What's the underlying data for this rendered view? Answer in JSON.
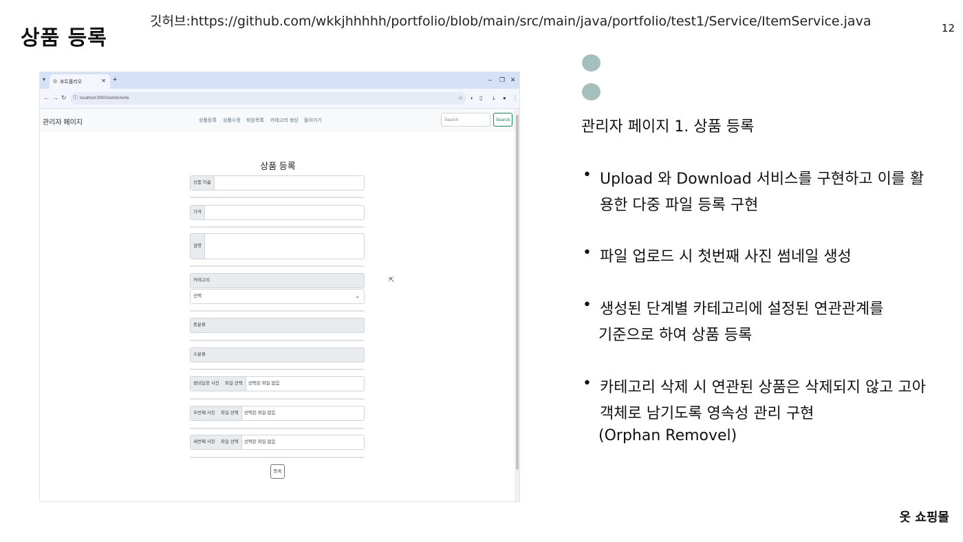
{
  "slide": {
    "title": "상품 등록",
    "github_link": "깃허브:https://github.com/wkkjhhhhh/portfolio/blob/main/src/main/java/portfolio/test1/Service/ItemService.java",
    "page_number": "12",
    "footer_brand": "옷 쇼핑몰"
  },
  "browser": {
    "tab_title": "포트폴리오",
    "url": "localhost:9000/Admin/write",
    "brand": "관리자 페이지",
    "nav_links": [
      "상품등록",
      "상품수정",
      "회원목록",
      "카테고리 생성",
      "돌아가기"
    ],
    "search_placeholder": "Search",
    "search_button": "Search"
  },
  "form": {
    "title": "상품 등록",
    "name_label": "상품 이름",
    "price_label": "가격",
    "description_label": "설명",
    "category_label": "카테고리",
    "category_selected": "선택",
    "mid_category": "중분류",
    "sub_category": "소분류",
    "thumbnail_label": "썸네일용 사진",
    "second_photo_label": "두번째 사진",
    "third_photo_label": "세번째 사진",
    "choose_file": "파일 선택",
    "no_file": "선택된 파일 없음",
    "submit": "등록"
  },
  "panel": {
    "heading": "관리자 페이지 1. 상품 등록",
    "bullets": [
      [
        "Upload 와 Download 서비스를 구현하고 이를 활",
        "용한 다중 파일 등록 구현"
      ],
      [
        "파일 업로드 시 첫번째 사진 썸네일 생성"
      ],
      [
        "생성된 단계별 카테고리에 설정된 연관관계를",
        "기준으로 하여 상품 등록"
      ],
      [
        "카테고리 삭제 시 연관된 상품은 삭제되지 않고 고아",
        "객체로 남기도록 영속성 관리 구현",
        "(Orphan Removel)"
      ]
    ],
    "dot_color": "#a5bfbd"
  }
}
